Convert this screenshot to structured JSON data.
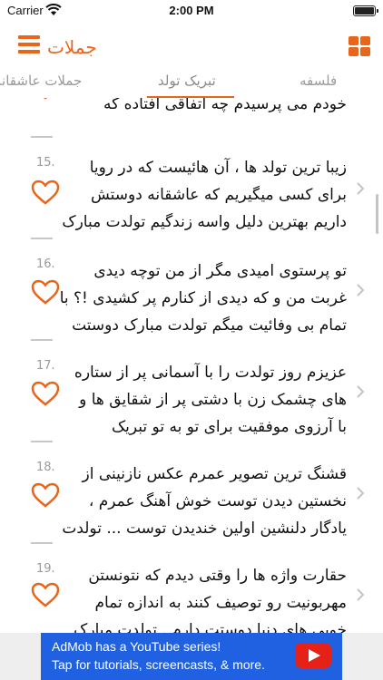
{
  "status_bar": {
    "carrier": "Carrier",
    "time": "2:00 PM"
  },
  "navbar": {
    "title": "جملات"
  },
  "tabs": [
    {
      "label": "جملات عاشقانه"
    },
    {
      "label": "تبریک تولد",
      "selected": true
    },
    {
      "label": "فلسفه"
    }
  ],
  "partial_item": {
    "text": "خودم می پرسیدم چه اتفاقی افتاده که"
  },
  "items": [
    {
      "num": "15.",
      "lines": [
        "زیبا ترین تولد ها ، آن هائیست که در رویا",
        "برای کسی میگیریم که عاشقانه دوستش",
        "داریم بهترین دلیل واسه زندگیم تولدت مبارک"
      ]
    },
    {
      "num": "16.",
      "lines": [
        "تو پرستوی امیدی مگر از من توچه دیدی",
        "غربت من و که دیدی از کنارم پر کشیدی !؟ با",
        "تمام بی وفائیت میگم تولدت مبارک دوستت"
      ]
    },
    {
      "num": "17.",
      "lines": [
        "عزیزم روز تولدت را با آسمانی پر از ستاره",
        "های چشمک زن با دشتی پر از شقایق ها و",
        "با آرزوی موفقیت برای تو به تو تبریک"
      ]
    },
    {
      "num": "18.",
      "lines": [
        "قشنگ ترین تصویر عمرم عکس نازنینی از",
        "نخستین دیدن توست خوش آهنگ عمرم ،",
        "یادگار دلنشین اولین خندیدن توست ... تولدت"
      ]
    },
    {
      "num": "19.",
      "lines": [
        "حقارت واژه ها را وقتی دیدم که نتونستن",
        "مهربونیت رو توصیف کنند به اندازه تمام",
        "خوبی های دنیا دوستت دارم . تولدت مبارک"
      ]
    }
  ],
  "ad": {
    "line1": "AdMob has a YouTube series!",
    "line2": "Tap for tutorials, screencasts, & more."
  },
  "colors": {
    "accent": "#e8661c",
    "ad_blue": "#1f61e0"
  }
}
